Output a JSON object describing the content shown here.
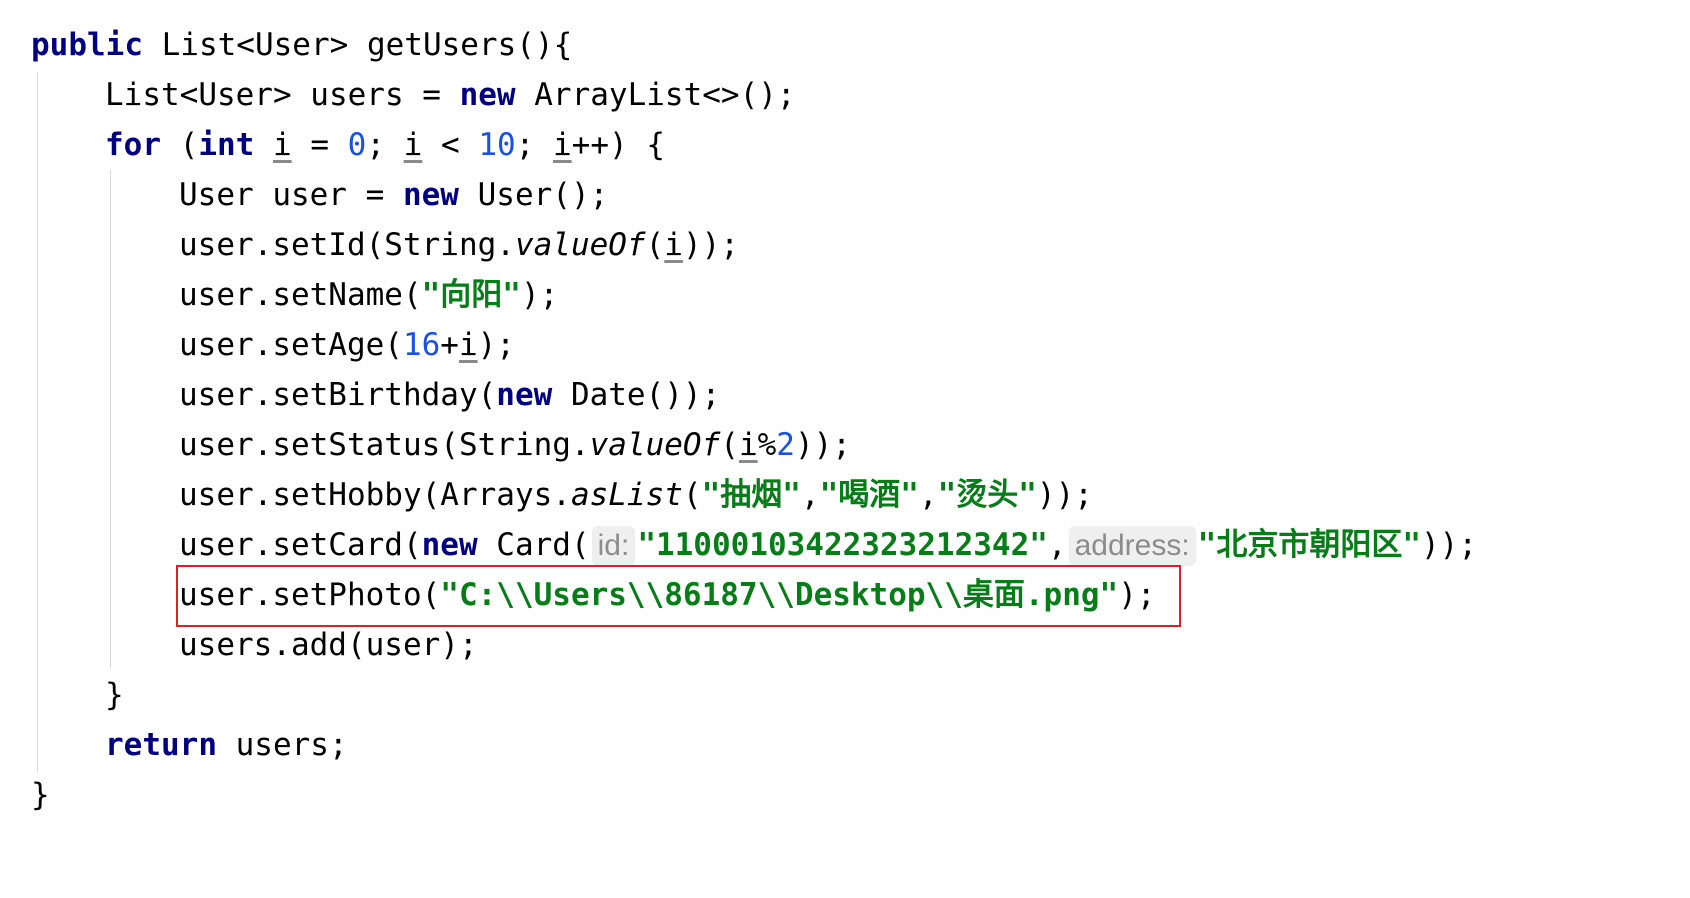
{
  "code": {
    "l1": {
      "kw": "public",
      "t1": " List<User> getUsers(){"
    },
    "l2": {
      "t1": "List<User> users = ",
      "kw": "new",
      "t2": " ArrayList<>();"
    },
    "l3": {
      "kw_for": "for",
      "t1": " (",
      "kw_int": "int",
      "t2": " ",
      "v1": "i",
      "t3": " = ",
      "n1": "0",
      "t4": "; ",
      "v2": "i",
      "t5": " < ",
      "n2": "10",
      "t6": "; ",
      "v3": "i",
      "t7": "++) {"
    },
    "l4": {
      "t1": "User user = ",
      "kw": "new",
      "t2": " User();"
    },
    "l5": {
      "t1": "user.setId(String.",
      "it": "valueOf",
      "t2": "(",
      "v": "i",
      "t3": "));"
    },
    "l6": {
      "t1": "user.setName(",
      "s": "\"向阳\"",
      "t2": ");"
    },
    "l7": {
      "t1": "user.setAge(",
      "n": "16",
      "t2": "+",
      "v": "i",
      "t3": ");"
    },
    "l8": {
      "t1": "user.setBirthday(",
      "kw": "new",
      "t2": " Date());"
    },
    "l9": {
      "t1": "user.setStatus(String.",
      "it": "valueOf",
      "t2": "(",
      "v": "i",
      "t3": "%",
      "n": "2",
      "t4": "));"
    },
    "l10": {
      "t1": "user.setHobby(Arrays.",
      "it": "asList",
      "t2": "(",
      "s1": "\"抽烟\"",
      "c1": ",",
      "s2": "\"喝酒\"",
      "c2": ",",
      "s3": "\"烫头\"",
      "t3": "));"
    },
    "l11": {
      "t1": "user.setCard(",
      "kw": "new",
      "t2": " Card(",
      "h1": "id:",
      "s1": "\"11000103422323212342\"",
      "c1": ",",
      "h2": "address:",
      "s2": "\"北京市朝阳区\"",
      "t3": "));"
    },
    "l12": {
      "t1": "user.setPhoto(",
      "s": "\"C:\\\\Users\\\\86187\\\\Desktop\\\\桌面.png\"",
      "t2": ");"
    },
    "l13": {
      "t1": "users.add(user);"
    },
    "l14": {
      "t1": "}"
    },
    "l15": {
      "kw": "return",
      "t1": " users;"
    },
    "l16": {
      "t1": "}"
    }
  }
}
